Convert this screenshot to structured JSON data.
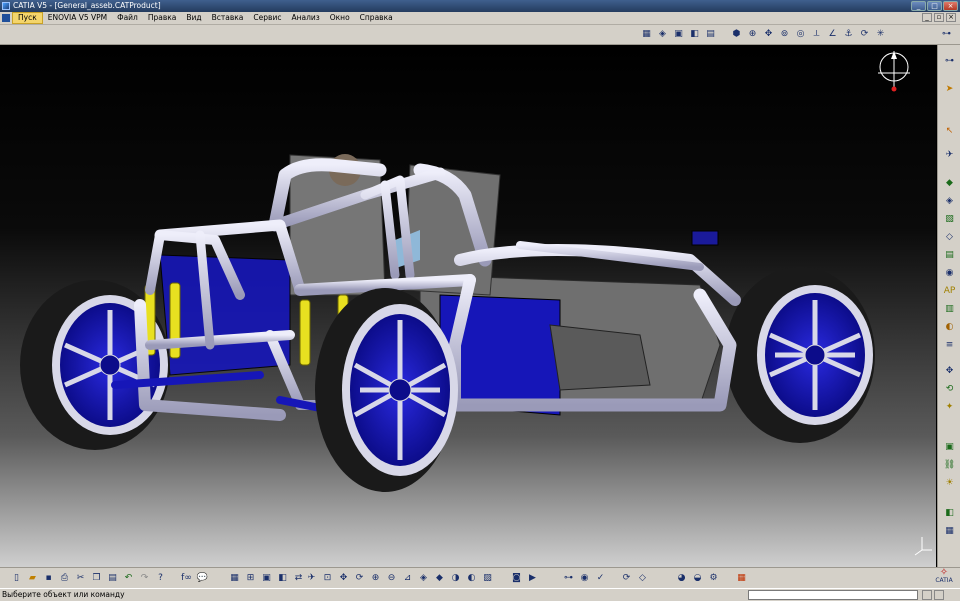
{
  "window": {
    "title": "CATIA V5 - [General_asseb.CATProduct]"
  },
  "menubar": {
    "items": [
      "Пуск",
      "ENOVIA V5 VPM",
      "Файл",
      "Правка",
      "Вид",
      "Вставка",
      "Сервис",
      "Анализ",
      "Окно",
      "Справка"
    ]
  },
  "statusbar": {
    "prompt": "Выберите объект или команду"
  },
  "logo": {
    "text": "CATIA"
  },
  "colors": {
    "frame_tube": "#c9c9dc",
    "chassis_blue": "#1616b8",
    "shock_yellow": "#e8e020",
    "panel_gray": "#6f6f6f",
    "tire": "#1a1a1a",
    "toolbar_bg": "#d4d0c8"
  },
  "icons": {
    "compass": "compass-icon",
    "select": "select-arrow-icon"
  }
}
